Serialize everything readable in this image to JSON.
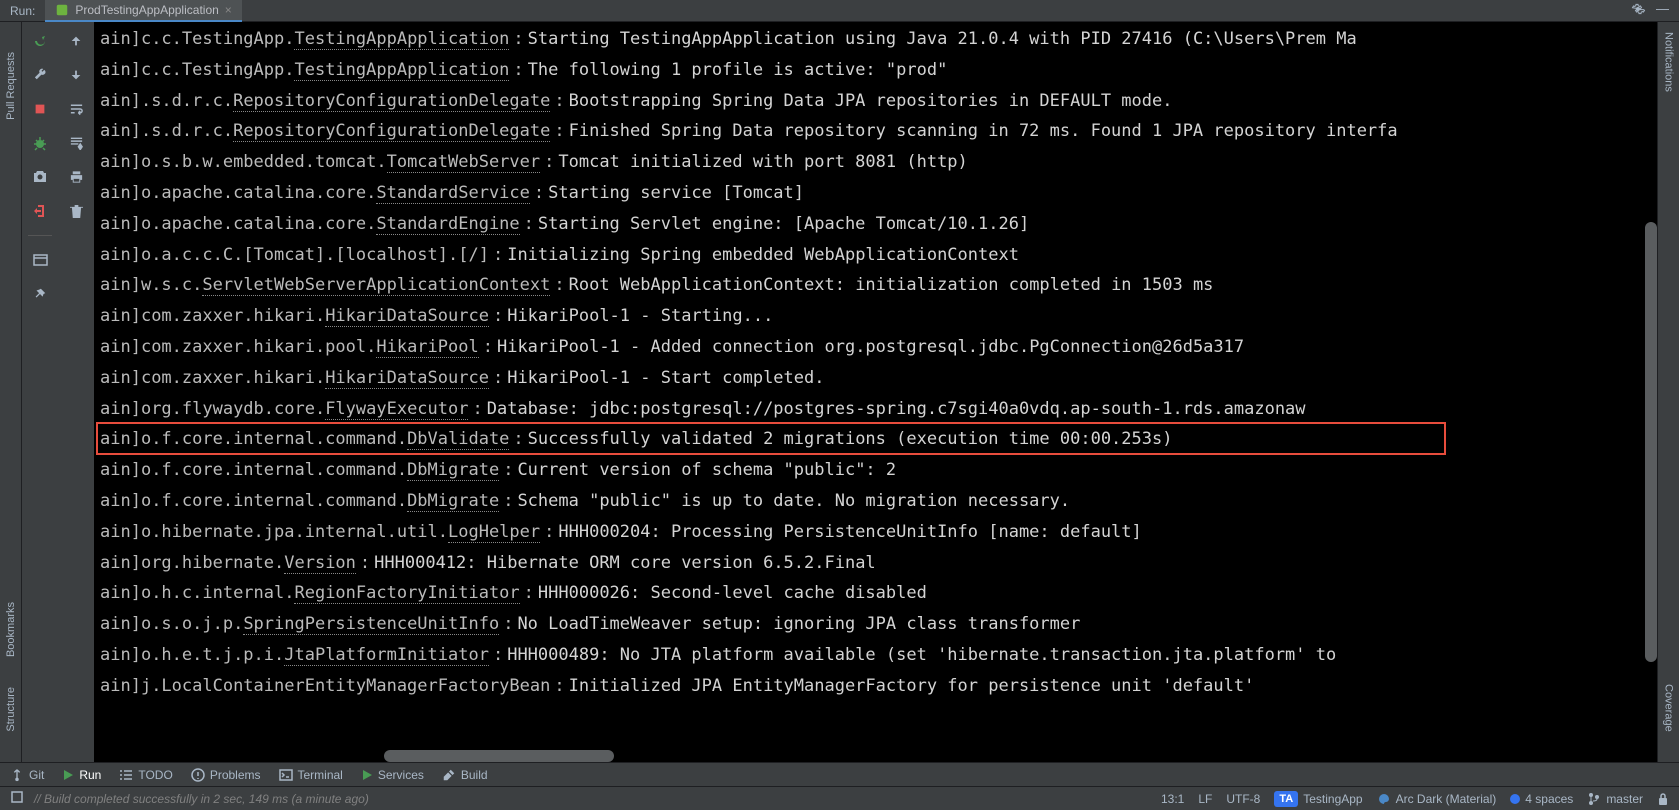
{
  "topbar": {
    "run_label": "Run:",
    "tab_name": "ProdTestingAppApplication"
  },
  "left_sidebar": {
    "pull_requests": "Pull Requests",
    "bookmarks": "Bookmarks",
    "structure": "Structure"
  },
  "right_sidebar": {
    "notifications": "Notifications",
    "coverage": "Coverage"
  },
  "console_lines": [
    {
      "prefix": "ain] ",
      "class_pre": "c.c.TestingApp.",
      "class_under": "TestingAppApplication",
      "pad": "   ",
      "msg": "Starting TestingAppApplication using Java 21.0.4 with PID 27416 (C:\\Users\\Prem Ma"
    },
    {
      "prefix": "ain] ",
      "class_pre": "c.c.TestingApp.",
      "class_under": "TestingAppApplication",
      "pad": "   ",
      "msg": "The following 1 profile is active: \"prod\""
    },
    {
      "prefix": "ain] ",
      "class_pre": ".s.d.r.c.",
      "class_under": "RepositoryConfigurationDelegate",
      "pad": " ",
      "msg": "Bootstrapping Spring Data JPA repositories in DEFAULT mode."
    },
    {
      "prefix": "ain] ",
      "class_pre": ".s.d.r.c.",
      "class_under": "RepositoryConfigurationDelegate",
      "pad": " ",
      "msg": "Finished Spring Data repository scanning in 72 ms. Found 1 JPA repository interfa"
    },
    {
      "prefix": "ain] ",
      "class_pre": "o.s.b.w.embedded.tomcat.",
      "class_under": "TomcatWebServer",
      "pad": "  ",
      "msg": "Tomcat initialized with port 8081 (http)"
    },
    {
      "prefix": "ain] ",
      "class_pre": "o.apache.catalina.core.",
      "class_under": "StandardService",
      "pad": "   ",
      "msg": "Starting service [Tomcat]"
    },
    {
      "prefix": "ain] ",
      "class_pre": "o.apache.catalina.core.",
      "class_under": "StandardEngine",
      "pad": "    ",
      "msg": "Starting Servlet engine: [Apache Tomcat/10.1.26]"
    },
    {
      "prefix": "ain] ",
      "class_pre": "o.a.c.c.C.[Tomcat].[localhost].[/]",
      "class_under": "",
      "pad": "       ",
      "msg": "Initializing Spring embedded WebApplicationContext"
    },
    {
      "prefix": "ain] ",
      "class_pre": "w.s.c.",
      "class_under": "ServletWebServerApplicationContext",
      "pad": " ",
      "msg": "Root WebApplicationContext: initialization completed in 1503 ms"
    },
    {
      "prefix": "ain] ",
      "class_pre": "com.zaxxer.hikari.",
      "class_under": "HikariDataSource",
      "pad": "       ",
      "msg": "HikariPool-1 - Starting..."
    },
    {
      "prefix": "ain] ",
      "class_pre": "com.zaxxer.hikari.pool.",
      "class_under": "HikariPool",
      "pad": "        ",
      "msg": "HikariPool-1 - Added connection org.postgresql.jdbc.PgConnection@26d5a317",
      "under_msg": "PgConnection@26d5a317"
    },
    {
      "prefix": "ain] ",
      "class_pre": "com.zaxxer.hikari.",
      "class_under": "HikariDataSource",
      "pad": "       ",
      "msg": "HikariPool-1 - Start completed."
    },
    {
      "prefix": "ain] ",
      "class_pre": "org.flywaydb.core.",
      "class_under": "FlywayExecutor",
      "pad": "         ",
      "msg": "Database: jdbc:postgresql://postgres-spring.c7sgi40a0vdq.ap-south-1.rds.amazonaw"
    },
    {
      "prefix": "ain] ",
      "class_pre": "o.f.core.internal.command.",
      "class_under": "DbValidate",
      "pad": "     ",
      "msg": "Successfully validated 2 migrations (execution time 00:00.253s)",
      "highlight": true
    },
    {
      "prefix": "ain] ",
      "class_pre": "o.f.core.internal.command.",
      "class_under": "DbMigrate",
      "pad": "      ",
      "msg": "Current version of schema \"public\": 2"
    },
    {
      "prefix": "ain] ",
      "class_pre": "o.f.core.internal.command.",
      "class_under": "DbMigrate",
      "pad": "      ",
      "msg": "Schema \"public\" is up to date. No migration necessary."
    },
    {
      "prefix": "ain] ",
      "class_pre": "o.hibernate.jpa.internal.util.",
      "class_under": "LogHelper",
      "pad": "  ",
      "msg": "HHH000204: Processing PersistenceUnitInfo [name: default]"
    },
    {
      "prefix": "ain] ",
      "class_pre": "org.hibernate.",
      "class_under": "Version",
      "pad": "                    ",
      "msg": "HHH000412: Hibernate ORM core version 6.5.2.Final"
    },
    {
      "prefix": "ain] ",
      "class_pre": "o.h.c.internal.",
      "class_under": "RegionFactoryInitiator",
      "pad": "    ",
      "msg": "HHH000026: Second-level cache disabled"
    },
    {
      "prefix": "ain] ",
      "class_pre": "o.s.o.j.p.",
      "class_under": "SpringPersistenceUnitInfo",
      "pad": "       ",
      "msg": "No LoadTimeWeaver setup: ignoring JPA class transformer"
    },
    {
      "prefix": "ain] ",
      "class_pre": "o.h.e.t.j.p.i.",
      "class_under": "JtaPlatformInitiator",
      "pad": "      ",
      "msg": "HHH000489: No JTA platform available (set 'hibernate.transaction.jta.platform' to"
    },
    {
      "prefix": "ain] ",
      "class_pre": "j.LocalContainerEntityManagerFactoryBean",
      "class_under": "",
      "pad": " ",
      "msg": "Initialized JPA EntityManagerFactory for persistence unit 'default'"
    }
  ],
  "bottom_toolbar": {
    "git": "Git",
    "run": "Run",
    "todo": "TODO",
    "problems": "Problems",
    "terminal": "Terminal",
    "services": "Services",
    "build": "Build"
  },
  "status_bar": {
    "build_msg": "// Build completed successfully in 2 sec, 149 ms (a minute ago)",
    "cursor": "13:1",
    "line_sep": "LF",
    "encoding": "UTF-8",
    "ta": "TA",
    "project": "TestingApp",
    "theme": "Arc Dark (Material)",
    "indent": "4 spaces",
    "branch": "master"
  }
}
